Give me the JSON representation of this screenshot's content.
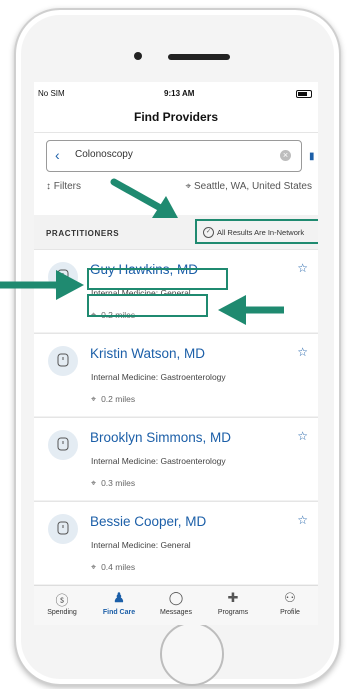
{
  "status_bar": {
    "carrier": "No SIM",
    "time": "9:13 AM"
  },
  "header": {
    "title": "Find Providers"
  },
  "search": {
    "value": "Colonoscopy",
    "back_icon": "chevron-left-icon",
    "clear_icon": "clear-icon",
    "map_icon": "map-icon"
  },
  "filters": {
    "label": "Filters",
    "location": "Seattle, WA, United States"
  },
  "section": {
    "title": "PRACTITIONERS",
    "badge": "All Results Are In-Network"
  },
  "providers": [
    {
      "name": "Guy Hawkins, MD",
      "specialty": "Internal Medicine: General",
      "distance": "0.2 miles"
    },
    {
      "name": "Kristin Watson, MD",
      "specialty": "Internal Medicine: Gastroenterology",
      "distance": "0.2 miles"
    },
    {
      "name": "Brooklyn Simmons, MD",
      "specialty": "Internal Medicine: Gastroenterology",
      "distance": "0.3 miles"
    },
    {
      "name": "Bessie Cooper, MD",
      "specialty": "Internal Medicine: General",
      "distance": "0.4 miles"
    }
  ],
  "tabs": [
    {
      "label": "Spending",
      "icon": "dollar-icon"
    },
    {
      "label": "Find Care",
      "icon": "doctor-icon",
      "active": true
    },
    {
      "label": "Messages",
      "icon": "chat-bubble-icon"
    },
    {
      "label": "Programs",
      "icon": "plus-cross-icon"
    },
    {
      "label": "Profile",
      "icon": "person-icon"
    }
  ],
  "colors": {
    "accent": "#1c5fa8",
    "highlight": "#1f8a70"
  }
}
